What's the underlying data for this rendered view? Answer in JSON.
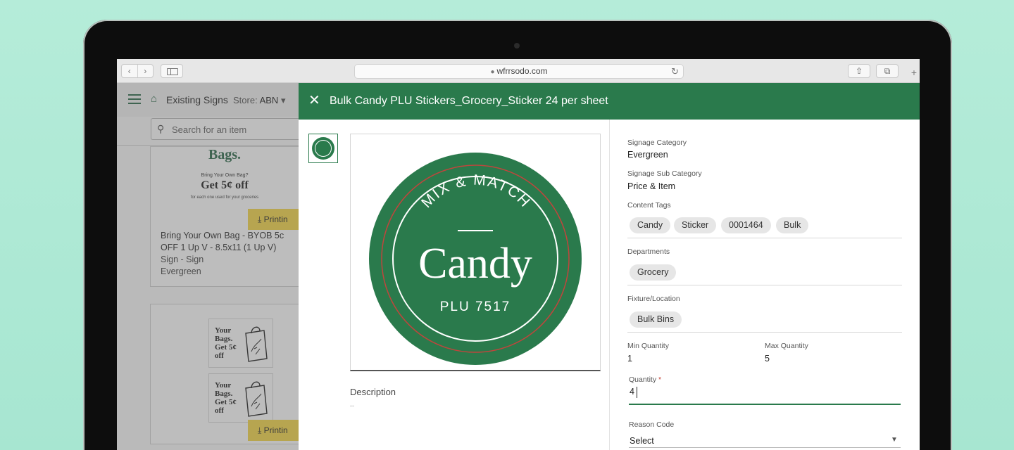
{
  "browser": {
    "url": "wfrrsodo.com",
    "back_icon": "chevron-left-icon",
    "forward_icon": "chevron-right-icon",
    "reload_icon": "reload-icon",
    "share_icon": "share-icon",
    "tabs_icon": "tabs-icon"
  },
  "app": {
    "title": "Existing Signs",
    "store_label": "Store:",
    "store_value": "ABN",
    "search_placeholder": "Search for an item",
    "cards": [
      {
        "poster_title": "Bags.",
        "poster_line1": "Bring Your Own Bag?",
        "poster_offer": "Get 5¢ off",
        "poster_line2": "for each one used for your groceries",
        "print_label": "Printin",
        "title_line1": "Bring Your Own Bag - BYOB 5c",
        "title_line2": "OFF 1 Up V - 8.5x11 (1 Up V)",
        "type": "Sign - Sign",
        "category": "Evergreen"
      },
      {
        "poster_text_1": "Your Bags. Get 5¢ off",
        "poster_text_2": "Your Bags. Get 5¢ off",
        "print_label": "Printin"
      }
    ]
  },
  "modal": {
    "title": "Bulk Candy PLU Stickers_Grocery_Sticker 24 per sheet",
    "sticker": {
      "top_text": "MIX & MATCH",
      "main_text": "Candy",
      "bottom_text": "PLU 7517",
      "color": "#2a7a4c"
    },
    "description_label": "Description",
    "description_value": "--",
    "signage_category_label": "Signage Category",
    "signage_category_value": "Evergreen",
    "signage_sub_category_label": "Signage Sub Category",
    "signage_sub_category_value": "Price & Item",
    "content_tags_label": "Content Tags",
    "content_tags": [
      "Candy",
      "Sticker",
      "0001464",
      "Bulk"
    ],
    "departments_label": "Departments",
    "departments": [
      "Grocery"
    ],
    "fixture_label": "Fixture/Location",
    "fixtures": [
      "Bulk Bins"
    ],
    "min_quantity_label": "Min Quantity",
    "min_quantity_value": "1",
    "max_quantity_label": "Max Quantity",
    "max_quantity_value": "5",
    "quantity_label": "Quantity",
    "quantity_required_mark": "*",
    "quantity_value": "4",
    "reason_code_label": "Reason Code",
    "reason_code_value": "Select"
  }
}
